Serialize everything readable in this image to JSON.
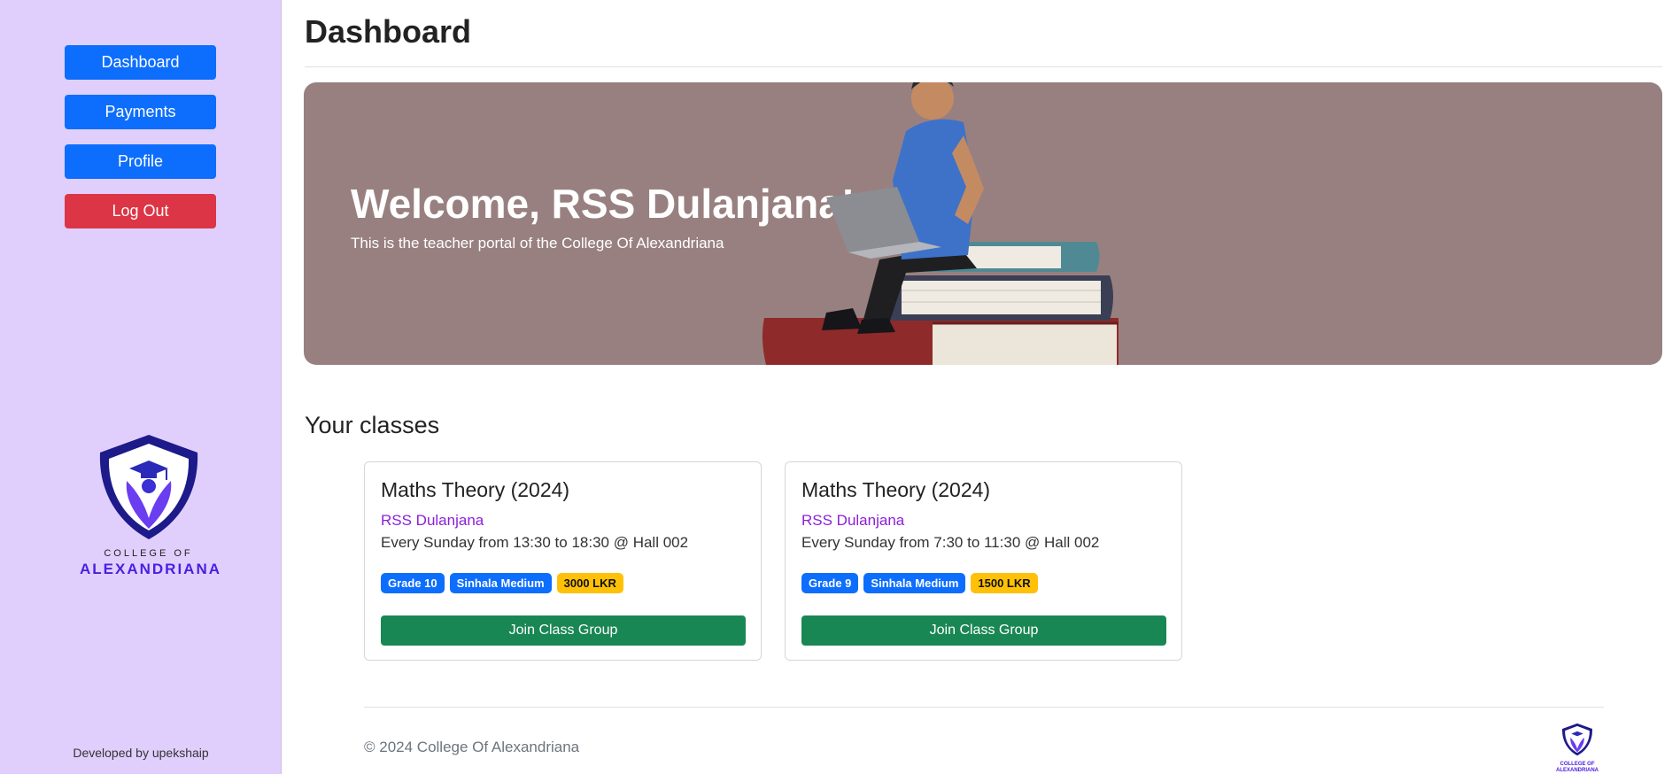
{
  "sidebar": {
    "nav": {
      "dashboard": "Dashboard",
      "payments": "Payments",
      "profile": "Profile",
      "logout": "Log Out"
    },
    "logo": {
      "line1": "COLLEGE OF",
      "line2": "ALEXANDRIANA",
      "icon": "shield-graduation-cap-icon"
    },
    "developer_credit": "Developed by upekshaip"
  },
  "header": {
    "title": "Dashboard"
  },
  "hero": {
    "title": "Welcome, RSS Dulanjana!",
    "subtitle": "This is the teacher portal of the College Of Alexandriana",
    "illustration": "person-with-laptop-on-books-illustration"
  },
  "classes": {
    "section_title": "Your classes",
    "items": [
      {
        "title": "Maths Theory (2024)",
        "teacher": "RSS Dulanjana",
        "schedule": "Every Sunday from 13:30 to 18:30 @ Hall 002",
        "badges": [
          "Grade 10",
          "Sinhala Medium",
          "3000 LKR"
        ],
        "button": "Join Class Group"
      },
      {
        "title": "Maths Theory (2024)",
        "teacher": "RSS Dulanjana",
        "schedule": "Every Sunday from 7:30 to 11:30 @ Hall 002",
        "badges": [
          "Grade 9",
          "Sinhala Medium",
          "1500 LKR"
        ],
        "button": "Join Class Group"
      }
    ]
  },
  "footer": {
    "copyright": "© 2024 College Of Alexandriana",
    "logo_line1": "COLLEGE OF",
    "logo_line2": "ALEXANDRIANA"
  },
  "colors": {
    "sidebar_bg": "#e0cffd",
    "primary": "#0d6efd",
    "danger": "#dc3545",
    "success": "#198754",
    "warning": "#ffc107",
    "hero_bg": "#998080",
    "teacher_text": "#8c20d8"
  }
}
